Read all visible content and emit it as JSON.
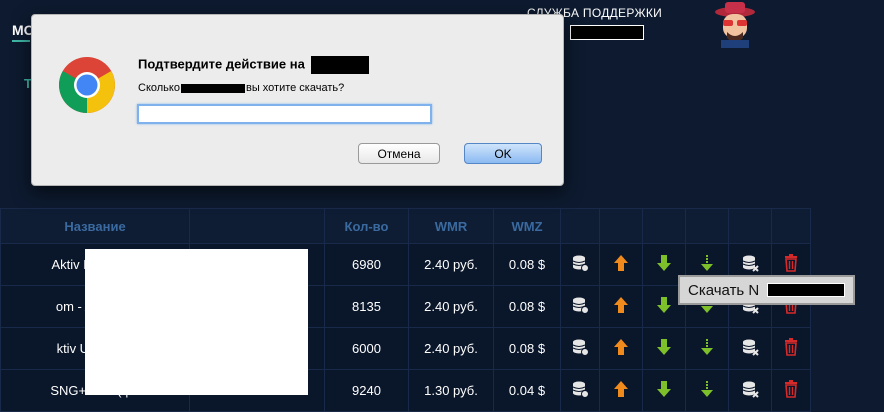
{
  "page": {
    "title_partial": "МО",
    "tab_partial": "Т"
  },
  "support": {
    "label": "СЛУЖБА ПОДДЕРЖКИ"
  },
  "table": {
    "headers": [
      "Название",
      "Кол-во",
      "WMR",
      "WMZ"
    ],
    "rows": [
      {
        "name": "Aktiv Russia (c",
        "qty": "6980",
        "wmr": "2.40 руб.",
        "wmz": "0.08 $"
      },
      {
        "name": "om - Aktiv Ru",
        "qty": "8135",
        "wmr": "2.40 руб.",
        "wmz": "0.08 $"
      },
      {
        "name": "ktiv Ukraine (",
        "qty": "6000",
        "wmr": "2.40 руб.",
        "wmz": "0.08 $"
      },
      {
        "name": "SNG+UKR (фс",
        "qty": "9240",
        "wmr": "1.30 руб.",
        "wmz": "0.04 $"
      }
    ],
    "action_icons": [
      "database-gear-icon",
      "arrow-up-icon",
      "arrow-down-icon",
      "download-dotted-icon",
      "database-remove-icon",
      "trash-icon"
    ]
  },
  "tooltip": {
    "text": "Скачать N"
  },
  "dialog": {
    "title": "Подтвердите действие на",
    "message_before": "Сколько",
    "message_after": "вы хотите скачать?",
    "input_value": "",
    "cancel_label": "Отмена",
    "ok_label": "OK"
  },
  "colors": {
    "background": "#0d1a2f",
    "accent": "#3fb7a6",
    "header_text": "#3a6aa0",
    "arrow_up": "#f08a1c",
    "arrow_down": "#7ec02a",
    "trash": "#d62a2a"
  }
}
